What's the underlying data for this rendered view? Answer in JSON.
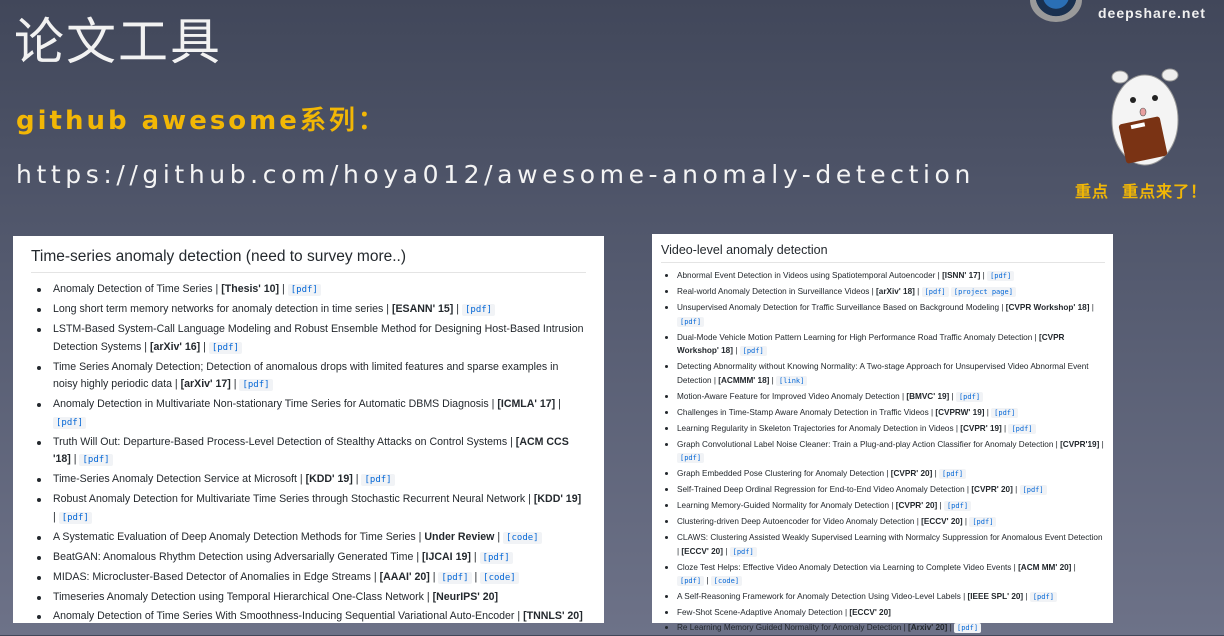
{
  "header": {
    "title": "论文工具",
    "subtitle": "github awesome系列：",
    "url": "https://github.com/hoya012/awesome-anomaly-detection"
  },
  "brand": {
    "site": "deepshare.net",
    "slogan": "重点  重点来了！",
    "accent": "#f2b705"
  },
  "left_panel": {
    "heading": "Time-series anomaly detection (need to survey more..)",
    "items": [
      {
        "title": "Anomaly Detection of Time Series",
        "venue": "[Thesis' 10]",
        "links": [
          "[pdf]"
        ]
      },
      {
        "title": "Long short term memory networks for anomaly detection in time series",
        "venue": "[ESANN' 15]",
        "links": [
          "[pdf]"
        ]
      },
      {
        "title": "LSTM-Based System-Call Language Modeling and Robust Ensemble Method for Designing Host-Based Intrusion Detection Systems",
        "venue": "[arXiv' 16]",
        "links": [
          "[pdf]"
        ]
      },
      {
        "title": "Time Series Anomaly Detection; Detection of anomalous drops with limited features and sparse examples in noisy highly periodic data",
        "venue": "[arXiv' 17]",
        "links": [
          "[pdf]"
        ]
      },
      {
        "title": "Anomaly Detection in Multivariate Non-stationary Time Series for Automatic DBMS Diagnosis",
        "venue": "[ICMLA' 17]",
        "links": [
          "[pdf]"
        ]
      },
      {
        "title": "Truth Will Out: Departure-Based Process-Level Detection of Stealthy Attacks on Control Systems",
        "venue": "[ACM CCS '18]",
        "links": [
          "[pdf]"
        ]
      },
      {
        "title": "Time-Series Anomaly Detection Service at Microsoft",
        "venue": "[KDD' 19]",
        "links": [
          "[pdf]"
        ]
      },
      {
        "title": "Robust Anomaly Detection for Multivariate Time Series through Stochastic Recurrent Neural Network",
        "venue": "[KDD' 19]",
        "links": [
          "[pdf]"
        ]
      },
      {
        "title": "A Systematic Evaluation of Deep Anomaly Detection Methods for Time Series",
        "venue": "Under Review",
        "links": [
          "[code]"
        ]
      },
      {
        "title": "BeatGAN: Anomalous Rhythm Detection using Adversarially Generated Time",
        "venue": "[IJCAI 19]",
        "links": [
          "[pdf]"
        ]
      },
      {
        "title": "MIDAS: Microcluster-Based Detector of Anomalies in Edge Streams",
        "venue": "[AAAI' 20]",
        "links": [
          "[pdf]",
          "[code]"
        ]
      },
      {
        "title": "Timeseries Anomaly Detection using Temporal Hierarchical One-Class Network",
        "venue": "[NeurIPS' 20]",
        "links": []
      },
      {
        "title": "Anomaly Detection of Time Series With Smoothness-Inducing Sequential Variational Auto-Encoder",
        "venue": "[TNNLS' 20]",
        "links": []
      }
    ]
  },
  "right_panel": {
    "heading": "Video-level anomaly detection",
    "items": [
      {
        "title": "Abnormal Event Detection in Videos using Spatiotemporal Autoencoder",
        "venue": "[ISNN' 17]",
        "links": [
          "[pdf]"
        ]
      },
      {
        "title": "Real-world Anomaly Detection in Surveillance Videos",
        "venue": "[arXiv' 18]",
        "links": [
          "[pdf]",
          "[project page]"
        ]
      },
      {
        "title": "Unsupervised Anomaly Detection for Traffic Surveillance Based on Background Modeling",
        "venue": "[CVPR Workshop' 18]",
        "links": [
          "[pdf]"
        ]
      },
      {
        "title": "Dual-Mode Vehicle Motion Pattern Learning for High Performance Road Traffic Anomaly Detection",
        "venue": "[CVPR Workshop' 18]",
        "links": [
          "[pdf]"
        ]
      },
      {
        "title": "Detecting Abnormality without Knowing Normality: A Two-stage Approach for Unsupervised Video Abnormal Event Detection",
        "venue": "[ACMMM' 18]",
        "links": [
          "[link]"
        ]
      },
      {
        "title": "Motion-Aware Feature for Improved Video Anomaly Detection",
        "venue": "[BMVC' 19]",
        "links": [
          "[pdf]"
        ]
      },
      {
        "title": "Challenges in Time-Stamp Aware Anomaly Detection in Traffic Videos",
        "venue": "[CVPRW' 19]",
        "links": [
          "[pdf]"
        ]
      },
      {
        "title": "Learning Regularity in Skeleton Trajectories for Anomaly Detection in Videos",
        "venue": "[CVPR' 19]",
        "links": [
          "[pdf]"
        ]
      },
      {
        "title": "Graph Convolutional Label Noise Cleaner: Train a Plug-and-play Action Classifier for Anomaly Detection",
        "venue": "[CVPR'19]",
        "links": [
          "[pdf]"
        ]
      },
      {
        "title": "Graph Embedded Pose Clustering for Anomaly Detection",
        "venue": "[CVPR' 20]",
        "links": [
          "[pdf]"
        ]
      },
      {
        "title": "Self-Trained Deep Ordinal Regression for End-to-End Video Anomaly Detection",
        "venue": "[CVPR' 20]",
        "links": [
          "[pdf]"
        ]
      },
      {
        "title": "Learning Memory-Guided Normality for Anomaly Detection",
        "venue": "[CVPR' 20]",
        "links": [
          "[pdf]"
        ]
      },
      {
        "title": "Clustering-driven Deep Autoencoder for Video Anomaly Detection",
        "venue": "[ECCV' 20]",
        "links": [
          "[pdf]"
        ]
      },
      {
        "title": "CLAWS: Clustering Assisted Weakly Supervised Learning with Normalcy Suppression for Anomalous Event Detection",
        "venue": "[ECCV' 20]",
        "links": [
          "[pdf]"
        ]
      },
      {
        "title": "Cloze Test Helps: Effective Video Anomaly Detection via Learning to Complete Video Events",
        "venue": "[ACM MM' 20]",
        "links": [
          "[pdf]",
          "[code]"
        ]
      },
      {
        "title": "A Self-Reasoning Framework for Anomaly Detection Using Video-Level Labels",
        "venue": "[IEEE SPL' 20]",
        "links": [
          "[pdf]"
        ]
      },
      {
        "title": "Few-Shot Scene-Adaptive Anomaly Detection",
        "venue": "[ECCV' 20]",
        "links": []
      },
      {
        "title": "Re Learning Memory Guided Normality for Anomaly Detection",
        "venue": "[Arxiv' 20]",
        "links": [
          "[pdf]"
        ]
      }
    ]
  }
}
